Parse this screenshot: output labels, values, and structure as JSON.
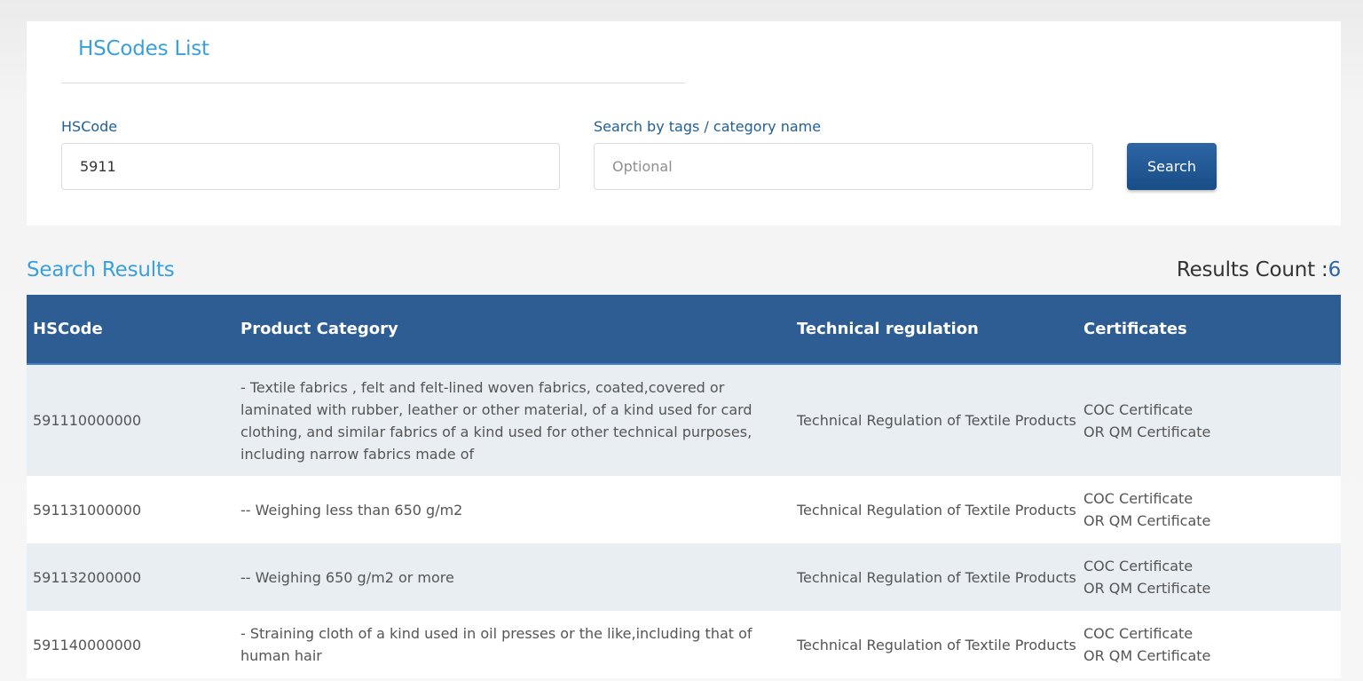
{
  "search_panel": {
    "title": "HSCodes List",
    "hscode_label": "HSCode",
    "hscode_value": "5911",
    "tags_label": "Search by tags / category name",
    "tags_placeholder": "Optional",
    "search_button": "Search"
  },
  "results": {
    "title": "Search Results",
    "count_label": "Results Count :",
    "count_value": "6",
    "columns": [
      "HSCode",
      "Product Category",
      "Technical regulation",
      "Certificates"
    ],
    "rows": [
      {
        "hscode": "591110000000",
        "category": "- Textile fabrics , felt and felt-lined woven fabrics, coated,covered or laminated with rubber, leather or other material, of a kind used for card clothing, and similar fabrics of a kind used for other technical purposes, including narrow fabrics made of",
        "regulation": "Technical Regulation of Textile Products",
        "cert_line1": "COC Certificate",
        "cert_line2": "OR QM Certificate"
      },
      {
        "hscode": "591131000000",
        "category": "-- Weighing less than 650 g/m2",
        "regulation": "Technical Regulation of Textile Products",
        "cert_line1": "COC Certificate",
        "cert_line2": "OR QM Certificate"
      },
      {
        "hscode": "591132000000",
        "category": "-- Weighing 650 g/m2 or more",
        "regulation": "Technical Regulation of Textile Products",
        "cert_line1": "COC Certificate",
        "cert_line2": "OR QM Certificate"
      },
      {
        "hscode": "591140000000",
        "category": "- Straining cloth of a kind used in oil presses or the like,including that of human hair",
        "regulation": "Technical Regulation of Textile Products",
        "cert_line1": "COC Certificate",
        "cert_line2": "OR QM Certificate"
      }
    ]
  },
  "colors": {
    "accent_title": "#3aa0dc",
    "label_blue": "#1f5f94",
    "header_bg": "#2d5d92",
    "button_bg": "#2d66a5",
    "row_alt_bg": "#e9eef2"
  }
}
